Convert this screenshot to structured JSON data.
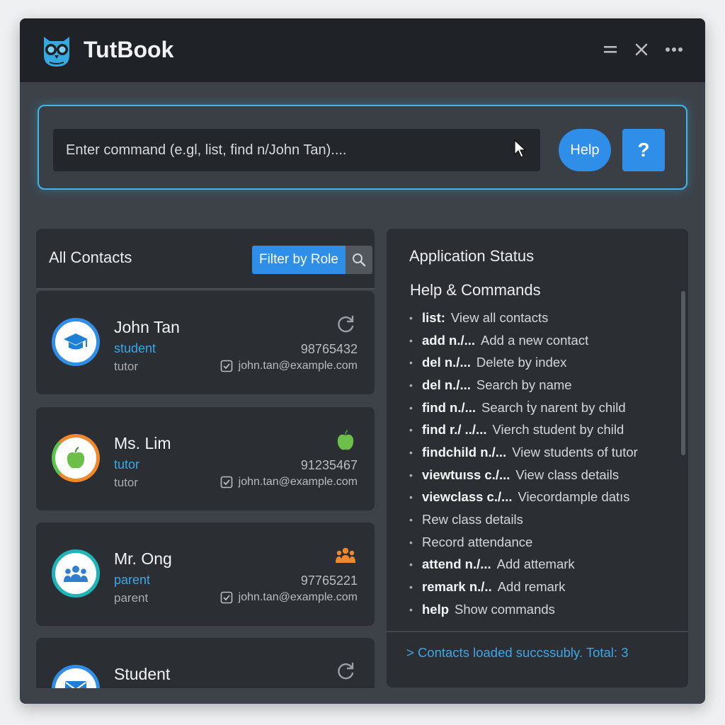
{
  "app": {
    "title": "TutBook",
    "accent_color": "#2f8ee8",
    "highlight_color": "#3fb7e6"
  },
  "window_controls": [
    "minimize-icon",
    "close-icon",
    "more-icon"
  ],
  "command_bar": {
    "placeholder": "Enter command (e.gl, list, find n/John Tan)....",
    "help_label": "Help",
    "question_label": "?"
  },
  "contacts": {
    "title": "All Contacts",
    "filter_label": "Filter by Role",
    "items": [
      {
        "name": "John Tan",
        "role": "student",
        "sub": "tutor",
        "phone": "98765432",
        "email": "john.tan@example.com",
        "avatar_icon": "graduation-cap-icon",
        "action_icon": "refresh-icon"
      },
      {
        "name": "Ms. Lim",
        "role": "tutor",
        "sub": "tutor",
        "phone": "91235467",
        "email": "john.tan@example.com",
        "avatar_icon": "apple-icon",
        "action_icon": "apple-icon"
      },
      {
        "name": "Mr. Ong",
        "role": "parent",
        "sub": "parent",
        "phone": "97765221",
        "email": "john.tan@example.com",
        "avatar_icon": "people-icon",
        "action_icon": "people-icon"
      },
      {
        "name": "Student",
        "avatar_icon": "envelope-icon",
        "action_icon": "refresh-icon"
      }
    ]
  },
  "status": {
    "title": "Application Status",
    "help_title": "Help & Commands",
    "commands": [
      {
        "cmd": "list:",
        "desc": "View all contacts"
      },
      {
        "cmd": "add n./...",
        "desc": "Add a new contact"
      },
      {
        "cmd": "del n./...",
        "desc": "Delete by index"
      },
      {
        "cmd": "del n./...",
        "desc": "Search by name"
      },
      {
        "cmd": "find n./...",
        "desc": "Search ṫy narent by child"
      },
      {
        "cmd": "find r./ ../...",
        "desc": "Vierch student by child"
      },
      {
        "cmd": "findchild n./...",
        "desc": "View students of tutor"
      },
      {
        "cmd": "viewtuıss c./...",
        "desc": "View class details"
      },
      {
        "cmd": "viewclass c./...",
        "desc": "Viecordample datıs"
      },
      {
        "cmd": "",
        "desc": "Rew class details"
      },
      {
        "cmd": "",
        "desc": "Record attendance"
      },
      {
        "cmd": "attend n./...",
        "desc": "Add attemark"
      },
      {
        "cmd": "remark n./..",
        "desc": "Add remark"
      },
      {
        "cmd": "help",
        "desc": "Show commands"
      }
    ],
    "message": "> Contacts loaded succssubly. Total: 3"
  }
}
